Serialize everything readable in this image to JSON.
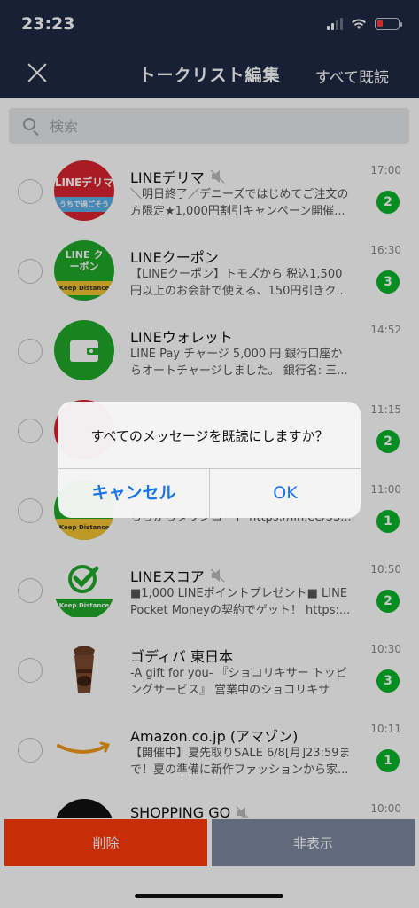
{
  "status": {
    "time": "23:23"
  },
  "nav": {
    "title": "トークリスト編集",
    "action": "すべて既読"
  },
  "search": {
    "placeholder": "検索"
  },
  "chats": [
    {
      "name": "LINEデリマ",
      "muted": true,
      "preview": "＼明日終了／デニーズではじめてご注文の方限定★1,000円割引キャンペーン開催...",
      "time": "17:00",
      "unread": "2",
      "avatar_text": "LINEデリマ",
      "avatar_sub": "うちで過ごそう",
      "avatar_color": "#d9252f"
    },
    {
      "name": "LINEクーポン",
      "muted": false,
      "preview": "【LINEクーポン】トモズから 税込1,500円以上のお会計で使える、150円引きク...",
      "time": "16:30",
      "unread": "3",
      "avatar_text": "LINE クーポン",
      "avatar_sub": "Keep Distance",
      "avatar_color": "#1faa2a"
    },
    {
      "name": "LINEウォレット",
      "muted": false,
      "preview": "LINE Pay チャージ 5,000 円 銀行口座からオートチャージしました。 銀行名: 三...",
      "time": "14:52",
      "unread": "",
      "avatar_text": "",
      "avatar_sub": "",
      "avatar_color": "#1faa2a"
    },
    {
      "name": "",
      "muted": false,
      "preview": "",
      "time": "11:15",
      "unread": "2",
      "avatar_text": "",
      "avatar_sub": "",
      "avatar_color": "#d9252f"
    },
    {
      "name": "",
      "muted": false,
      "preview": "ちらからダウンロード https://lin.ee/53...",
      "time": "11:00",
      "unread": "1",
      "avatar_text": "",
      "avatar_sub": "Keep Distance",
      "avatar_color": "#f4c430"
    },
    {
      "name": "LINEスコア",
      "muted": true,
      "preview": "■1,000 LINEポイントプレゼント■ LINE Pocket Moneyの契約でゲット！ https:...",
      "time": "10:50",
      "unread": "2",
      "avatar_text": "",
      "avatar_sub": "Keep Distance",
      "avatar_color": "#ffffff"
    },
    {
      "name": "ゴディバ 東日本",
      "muted": false,
      "preview": "-A gift for you- 『ショコリキサー トッピングサービス』 営業中のショコリキサー...",
      "time": "10:30",
      "unread": "3",
      "avatar_text": "",
      "avatar_sub": "",
      "avatar_color": "#ffffff"
    },
    {
      "name": "Amazon.co.jp (アマゾン)",
      "muted": false,
      "preview": "【開催中】夏先取りSALE 6/8[月]23:59まで！夏の準備に新作ファッションから家...",
      "time": "10:11",
      "unread": "1",
      "avatar_text": "",
      "avatar_sub": "",
      "avatar_color": "#ffffff"
    },
    {
      "name": "SHOPPING GO",
      "muted": true,
      "preview": "",
      "time": "10:00",
      "unread": "",
      "avatar_text": "",
      "avatar_sub": "",
      "avatar_color": "#111111"
    }
  ],
  "alert": {
    "message": "すべてのメッセージを既読にしますか？",
    "cancel": "キャンセル",
    "ok": "OK"
  },
  "bottom": {
    "delete": "削除",
    "hide": "非表示"
  },
  "colors": {
    "nav_bg": "#1f2a45",
    "badge": "#06b52b",
    "delete": "#ff3b0b",
    "hide": "#7d879f",
    "link": "#1a73e8"
  }
}
